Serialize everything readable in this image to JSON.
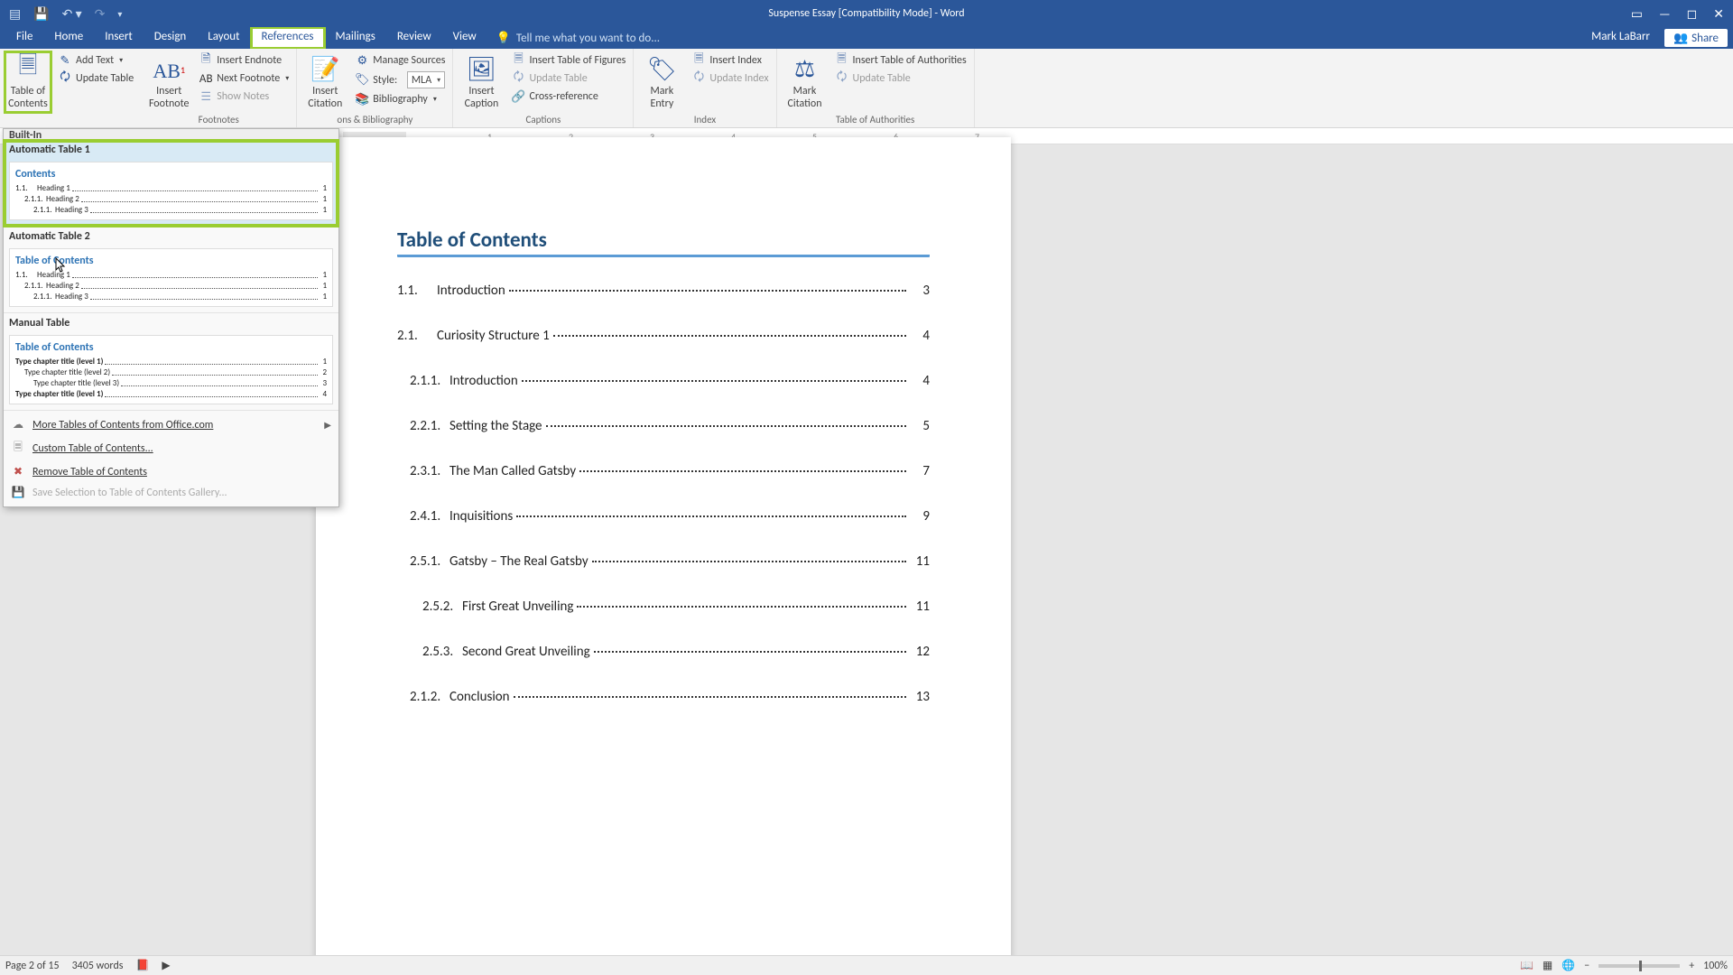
{
  "window": {
    "title": "Suspense Essay [Compatibility Mode] - Word",
    "user": "Mark LaBarr",
    "share": "Share"
  },
  "menu": {
    "tabs": [
      "File",
      "Home",
      "Insert",
      "Design",
      "Layout",
      "References",
      "Mailings",
      "Review",
      "View"
    ],
    "tell_me": "Tell me what you want to do..."
  },
  "ribbon": {
    "toc": {
      "label": "Table of\nContents",
      "add_text": "Add Text",
      "update": "Update Table"
    },
    "footnotes": {
      "button": "Insert\nFootnote",
      "endnote": "Insert Endnote",
      "next": "Next Footnote",
      "show": "Show Notes",
      "group": "Footnotes"
    },
    "citations": {
      "button": "Insert\nCitation",
      "manage": "Manage Sources",
      "style_label": "Style:",
      "style_value": "MLA",
      "biblio": "Bibliography",
      "group": "ons & Bibliography"
    },
    "captions": {
      "button": "Insert\nCaption",
      "insert_tof": "Insert Table of Figures",
      "update": "Update Table",
      "xref": "Cross-reference",
      "group": "Captions"
    },
    "index": {
      "button": "Mark\nEntry",
      "insert": "Insert Index",
      "update": "Update Index",
      "group": "Index"
    },
    "toa": {
      "button": "Mark\nCitation",
      "insert": "Insert Table of Authorities",
      "update": "Update Table",
      "group": "Table of Authorities"
    }
  },
  "dropdown": {
    "builtin_header": "Built-In",
    "auto1": {
      "title": "Automatic Table 1",
      "heading": "Contents",
      "rows": [
        {
          "n": "1.1.",
          "t": "Heading 1",
          "p": "1"
        },
        {
          "n": "2.1.1.",
          "t": "Heading 2",
          "p": "1"
        },
        {
          "n": "2.1.1.",
          "t": "Heading 3",
          "p": "1"
        }
      ]
    },
    "auto2": {
      "title": "Automatic Table 2",
      "heading": "Table of Contents",
      "rows": [
        {
          "n": "1.1.",
          "t": "Heading 1",
          "p": "1"
        },
        {
          "n": "2.1.1.",
          "t": "Heading 2",
          "p": "1"
        },
        {
          "n": "2.1.1.",
          "t": "Heading 3",
          "p": "1"
        }
      ]
    },
    "manual": {
      "title": "Manual Table",
      "heading": "Table of Contents",
      "rows": [
        {
          "t": "Type chapter title (level 1)",
          "p": "1"
        },
        {
          "t": "Type chapter title (level 2)",
          "p": "2"
        },
        {
          "t": "Type chapter title (level 3)",
          "p": "3"
        },
        {
          "t": "Type chapter title (level 1)",
          "p": "4"
        }
      ]
    },
    "menu": {
      "more": "More Tables of Contents from Office.com",
      "custom": "Custom Table of Contents...",
      "remove": "Remove Table of Contents",
      "save": "Save Selection to Table of Contents Gallery..."
    }
  },
  "document": {
    "title": "Table of Contents",
    "entries": [
      {
        "num": "1.1.",
        "title": "Introduction",
        "page": "3",
        "indent": 0
      },
      {
        "num": "2.1.",
        "title": "Curiosity Structure 1",
        "page": "4",
        "indent": 0
      },
      {
        "num": "2.1.1.",
        "title": "Introduction",
        "page": "4",
        "indent": 1
      },
      {
        "num": "2.2.1.",
        "title": "Setting the Stage",
        "page": "5",
        "indent": 1
      },
      {
        "num": "2.3.1.",
        "title": "The Man Called Gatsby",
        "page": "7",
        "indent": 1
      },
      {
        "num": "2.4.1.",
        "title": "Inquisitions",
        "page": "9",
        "indent": 1
      },
      {
        "num": "2.5.1.",
        "title": "Gatsby – The Real Gatsby",
        "page": "11",
        "indent": 1
      },
      {
        "num": "2.5.2.",
        "title": "First Great Unveiling",
        "page": "11",
        "indent": 2
      },
      {
        "num": "2.5.3.",
        "title": "Second Great Unveiling",
        "page": "12",
        "indent": 2
      },
      {
        "num": "2.1.2.",
        "title": "Conclusion",
        "page": "13",
        "indent": 1
      }
    ]
  },
  "ruler": {
    "ticks": [
      "1",
      "2",
      "3",
      "4",
      "5",
      "6",
      "7"
    ]
  },
  "status": {
    "page": "Page 2 of 15",
    "words": "3405 words",
    "zoom": "100%"
  }
}
